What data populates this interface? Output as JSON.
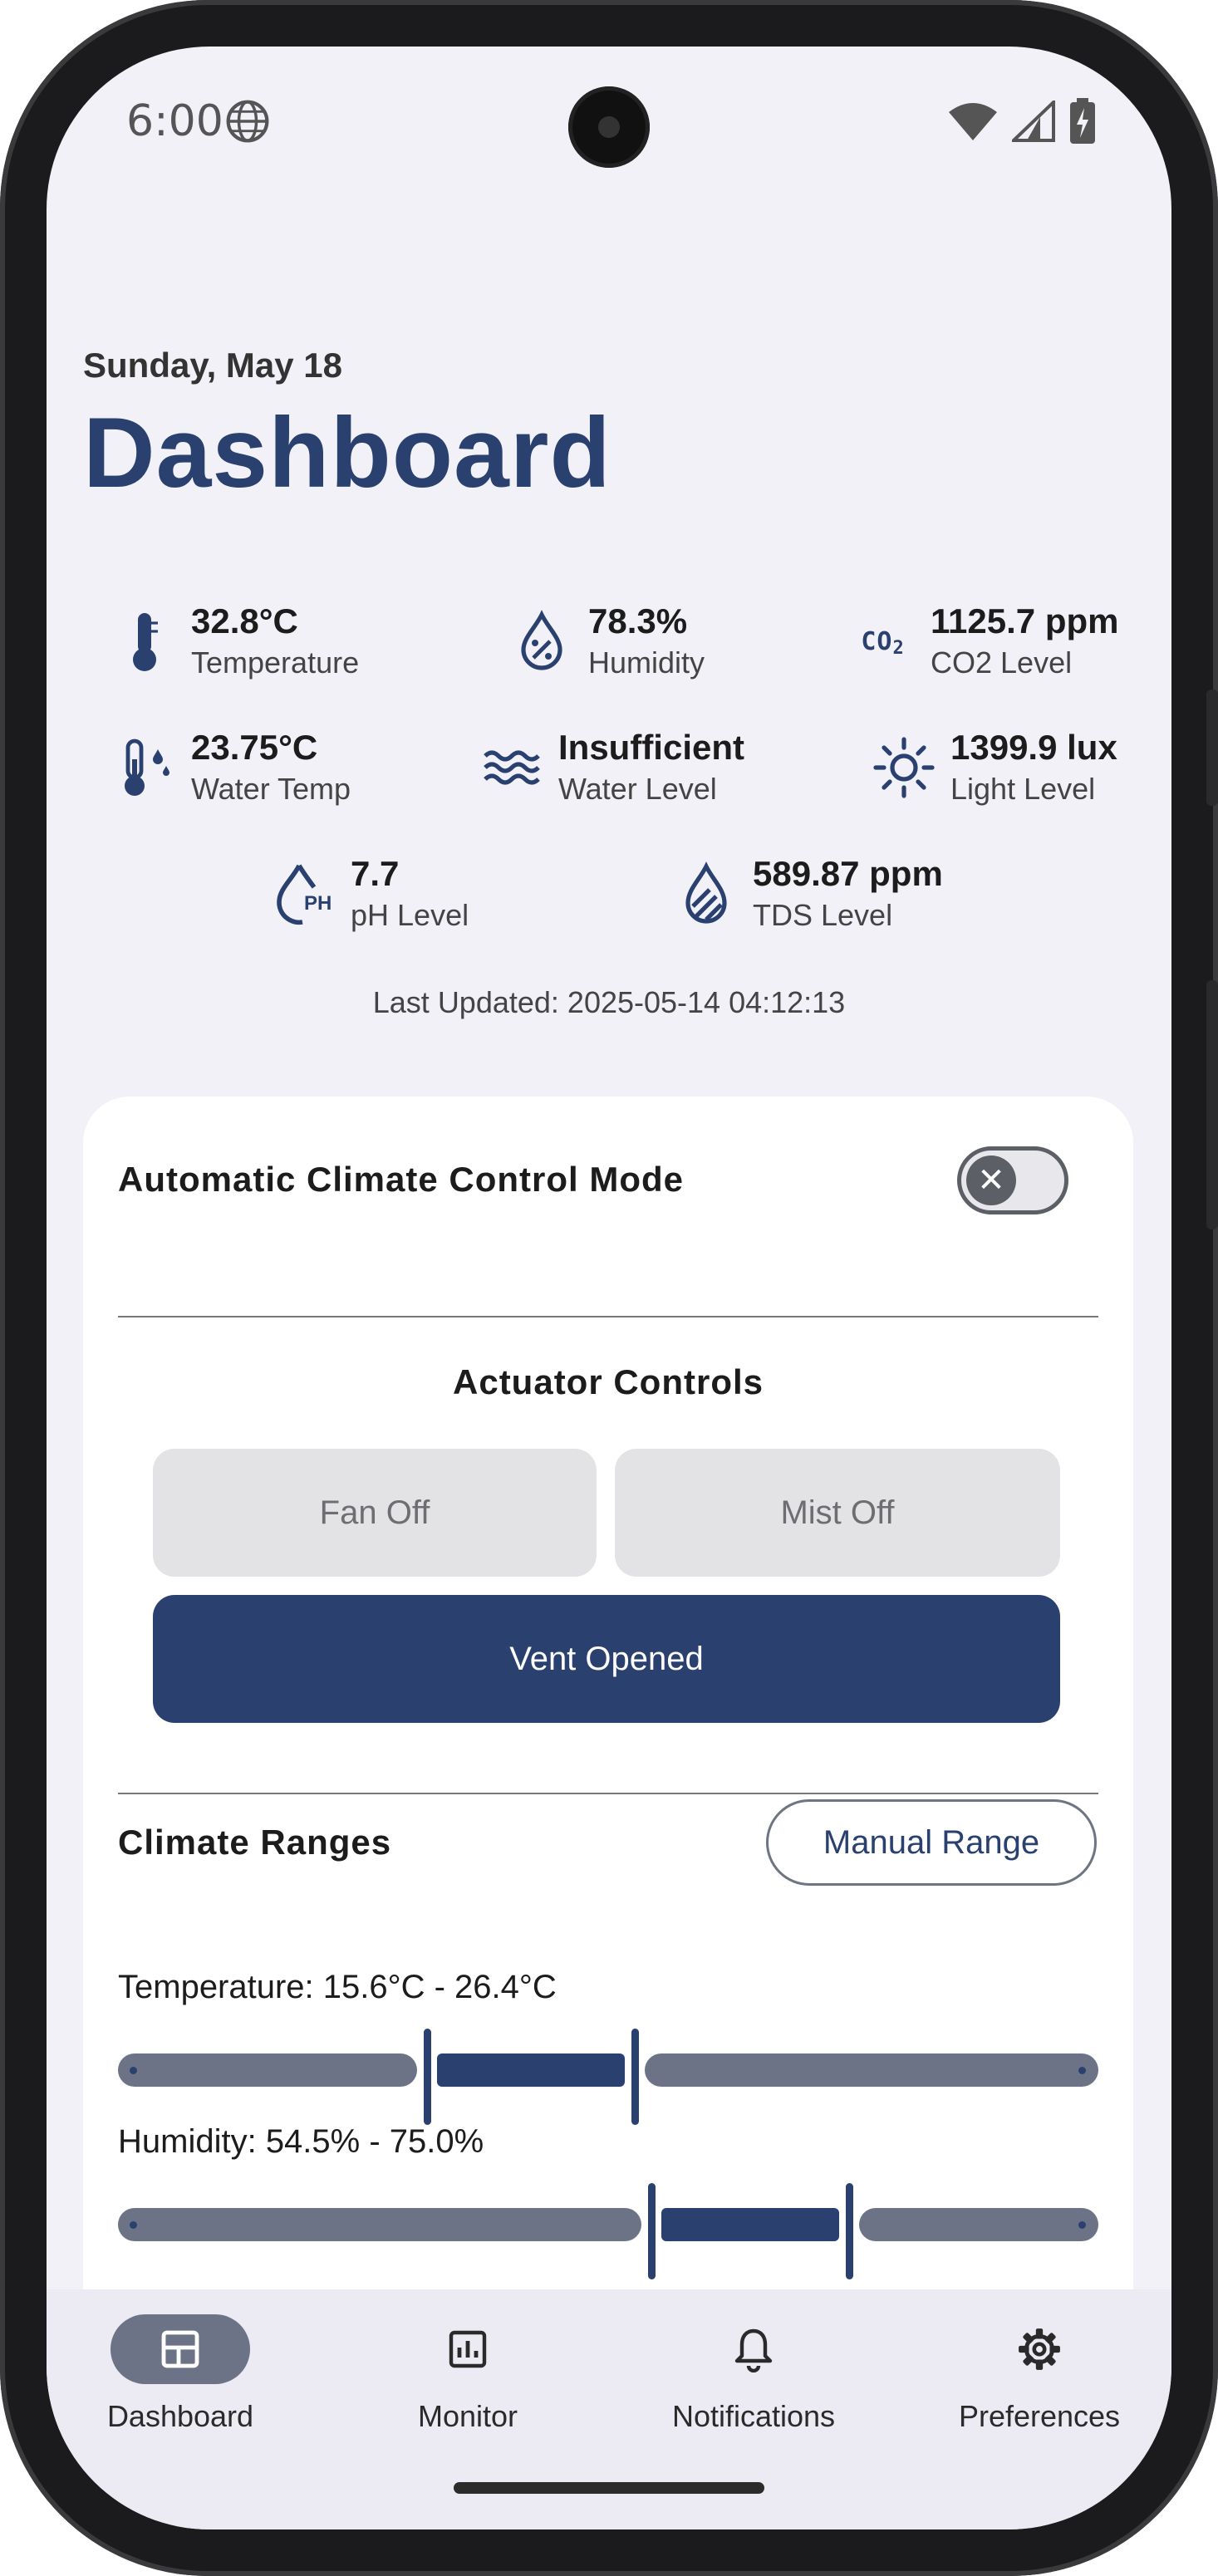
{
  "status": {
    "time": "6:00"
  },
  "header": {
    "date": "Sunday, May 18",
    "title": "Dashboard"
  },
  "sensors": [
    {
      "value": "32.8°C",
      "label": "Temperature",
      "icon": "thermometer-icon"
    },
    {
      "value": "78.3%",
      "label": "Humidity",
      "icon": "humidity-drop-icon"
    },
    {
      "value": "1125.7 ppm",
      "label": "CO2 Level",
      "icon": "co2-icon"
    },
    {
      "value": "23.75°C",
      "label": "Water Temp",
      "icon": "water-temp-icon"
    },
    {
      "value": "Insufficient",
      "label": "Water Level",
      "icon": "waves-icon"
    },
    {
      "value": "1399.9 lux",
      "label": "Light Level",
      "icon": "sun-icon"
    },
    {
      "value": "7.7",
      "label": "pH Level",
      "icon": "ph-drop-icon"
    },
    {
      "value": "589.87 ppm",
      "label": "TDS Level",
      "icon": "tds-drop-icon"
    }
  ],
  "ph_icon_text": "PH",
  "co2_icon_text": "CO",
  "co2_icon_sub": "2",
  "last_updated": "Last Updated: 2025-05-14 04:12:13",
  "card": {
    "auto_mode_label": "Automatic Climate Control Mode",
    "auto_mode_on": false,
    "actuator_title": "Actuator Controls",
    "fan_label": "Fan Off",
    "mist_label": "Mist Off",
    "vent_label": "Vent Opened",
    "ranges_title": "Climate Ranges",
    "manual_range_label": "Manual Range",
    "temperature_range": {
      "label": "Temperature: 15.6°C - 26.4°C",
      "min": 15.6,
      "max": 26.4,
      "scale_min": 0,
      "scale_max": 50
    },
    "humidity_range": {
      "label": "Humidity: 54.5% - 75.0%",
      "min": 54.5,
      "max": 75.0,
      "scale_min": 0,
      "scale_max": 100
    }
  },
  "nav": [
    {
      "label": "Dashboard",
      "icon": "dashboard-icon",
      "active": true
    },
    {
      "label": "Monitor",
      "icon": "monitor-chart-icon",
      "active": false
    },
    {
      "label": "Notifications",
      "icon": "bell-icon",
      "active": false
    },
    {
      "label": "Preferences",
      "icon": "gear-icon",
      "active": false
    }
  ],
  "colors": {
    "primary": "#2a4170",
    "track": "#6c7387",
    "background": "#f2f1f8"
  }
}
